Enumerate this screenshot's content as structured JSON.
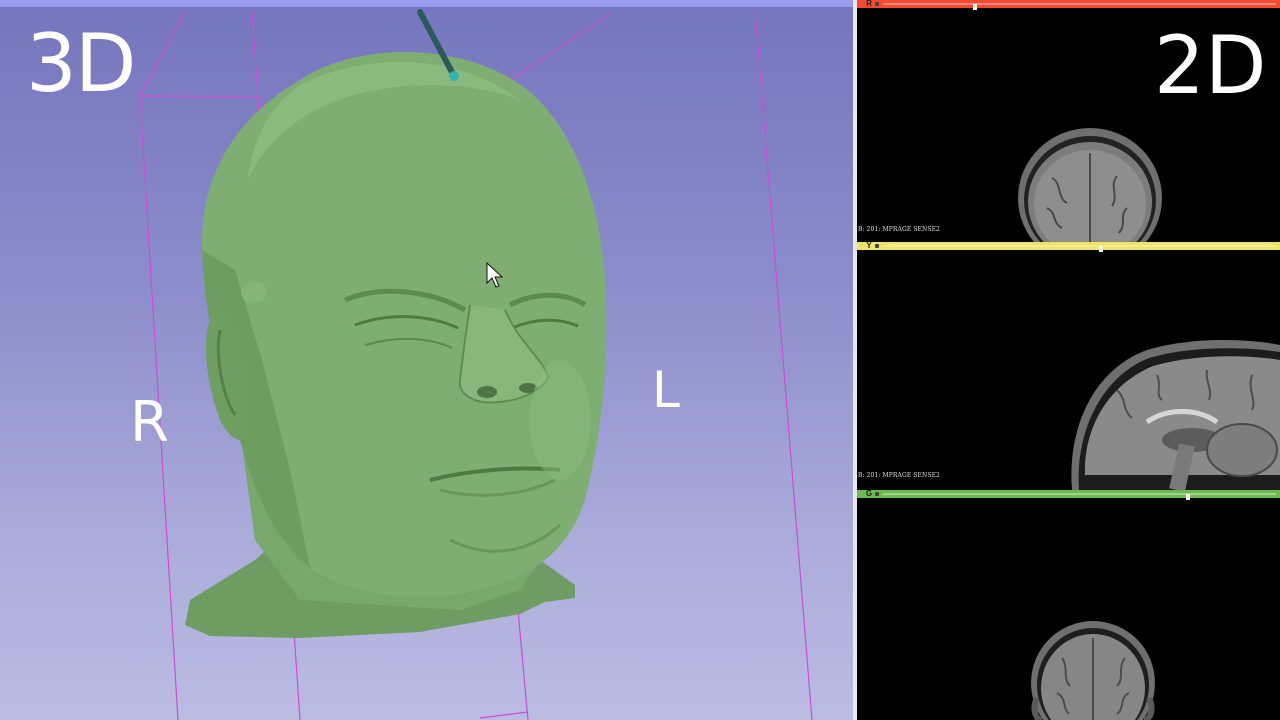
{
  "view3d": {
    "title": "3D",
    "orientation_right": "R",
    "orientation_left": "L",
    "background_top": "#7475bd",
    "background_bottom": "#bbbce2",
    "model_color": "#7fae72",
    "roi_box_color": "#d04bd6"
  },
  "view2d": {
    "title": "2D",
    "slices": [
      {
        "tag": "R",
        "color": "#f34a33",
        "caption": "B: 201: MPRAGE SENSE2",
        "slider_position": 0.23
      },
      {
        "tag": "Y",
        "color": "#ede466",
        "caption": "B: 201: MPRAGE SENSE2",
        "slider_position": 0.55
      },
      {
        "tag": "G",
        "color": "#6dbb4f",
        "caption": "",
        "slider_position": 0.77
      }
    ]
  }
}
